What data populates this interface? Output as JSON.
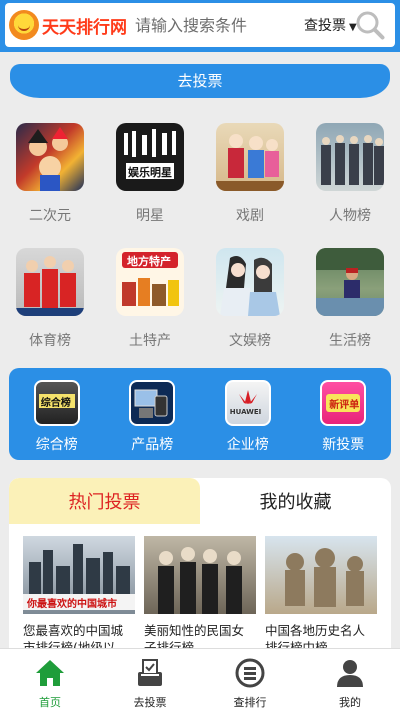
{
  "header": {
    "logo_text": "天天排行网",
    "search_placeholder": "请输入搜索条件",
    "search_type": "查投票",
    "caret": "▼"
  },
  "go_vote_label": "去投票",
  "categories": [
    {
      "label": "二次元",
      "icon": "anime-thumb"
    },
    {
      "label": "明星",
      "icon": "celebrity-thumb"
    },
    {
      "label": "戏剧",
      "icon": "opera-thumb"
    },
    {
      "label": "人物榜",
      "icon": "people-thumb"
    },
    {
      "label": "体育榜",
      "icon": "sports-thumb"
    },
    {
      "label": "土特产",
      "icon": "specialty-thumb",
      "thumb_text": "地方特产"
    },
    {
      "label": "文娱榜",
      "icon": "entertainment-thumb"
    },
    {
      "label": "生活榜",
      "icon": "life-thumb"
    }
  ],
  "celebrity_thumb_text": "娱乐明星",
  "rankings": [
    {
      "label": "综合榜",
      "thumb_text": "综合榜"
    },
    {
      "label": "产品榜",
      "thumb_text": ""
    },
    {
      "label": "企业榜",
      "thumb_text": "HUAWEI"
    },
    {
      "label": "新投票",
      "thumb_text": "新评单"
    }
  ],
  "tabs": [
    {
      "label": "热门投票",
      "active": true
    },
    {
      "label": "我的收藏",
      "active": false
    }
  ],
  "cards": [
    {
      "title": "您最喜欢的中国城市排行榜(地级以",
      "banner": "你最喜欢的中国城市"
    },
    {
      "title": "美丽知性的民国女子排行榜"
    },
    {
      "title": "中国各地历史名人排行榜中榜"
    }
  ],
  "nav": [
    {
      "label": "首页",
      "icon": "home-icon",
      "active": true
    },
    {
      "label": "去投票",
      "icon": "vote-icon",
      "active": false
    },
    {
      "label": "查排行",
      "icon": "ranking-icon",
      "active": false
    },
    {
      "label": "我的",
      "icon": "user-icon",
      "active": false
    }
  ],
  "colors": {
    "primary": "#2b8fe6",
    "active_nav": "#1f9d3a",
    "active_tab_bg": "#fbf1b8",
    "active_tab_text": "#dd2222"
  }
}
